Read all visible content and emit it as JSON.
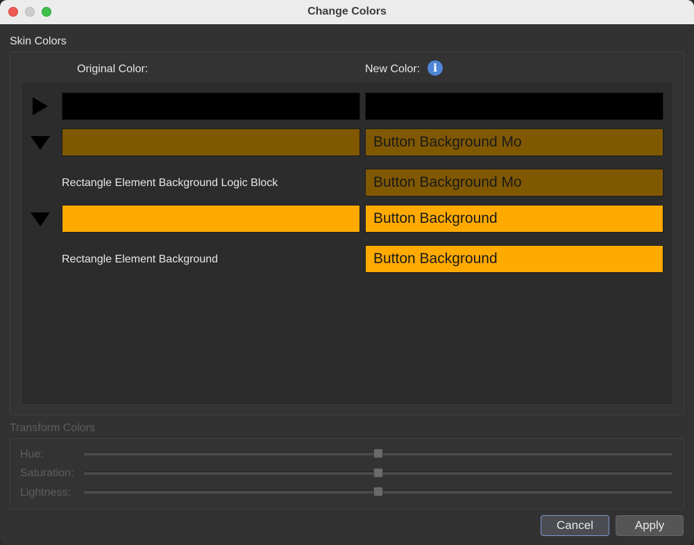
{
  "window": {
    "title": "Change Colors"
  },
  "skin_colors": {
    "label": "Skin Colors",
    "original_header": "Original Color:",
    "new_header": "New Color:",
    "info_icon_glyph": "i",
    "rows": [
      {
        "expander": "collapsed",
        "original_color": "#000000",
        "new_color": "#000000",
        "new_text": ""
      },
      {
        "expander": "expanded",
        "original_color": "#805800",
        "new_color": "#805800",
        "new_text": "Button Background Mo"
      },
      {
        "label": "Rectangle Element Background Logic Block",
        "new_color": "#805800",
        "new_text": "Button Background Mo"
      },
      {
        "expander": "expanded",
        "original_color": "#ffaa00",
        "new_color": "#ffaa00",
        "new_text": "Button Background"
      },
      {
        "label": "Rectangle Element Background",
        "new_color": "#ffaa00",
        "new_text": "Button Background"
      }
    ]
  },
  "transform_colors": {
    "label": "Transform Colors",
    "enabled": false,
    "sliders": [
      {
        "label": "Hue:",
        "value": 0.5
      },
      {
        "label": "Saturation:",
        "value": 0.5
      },
      {
        "label": "Lightness:",
        "value": 0.5
      }
    ]
  },
  "buttons": {
    "cancel": "Cancel",
    "apply": "Apply"
  },
  "colors": {
    "window_bg": "#323232",
    "titlebar_bg": "#ececec",
    "accent_focus": "#7d9ad3",
    "info_blue": "#4f85d6"
  }
}
